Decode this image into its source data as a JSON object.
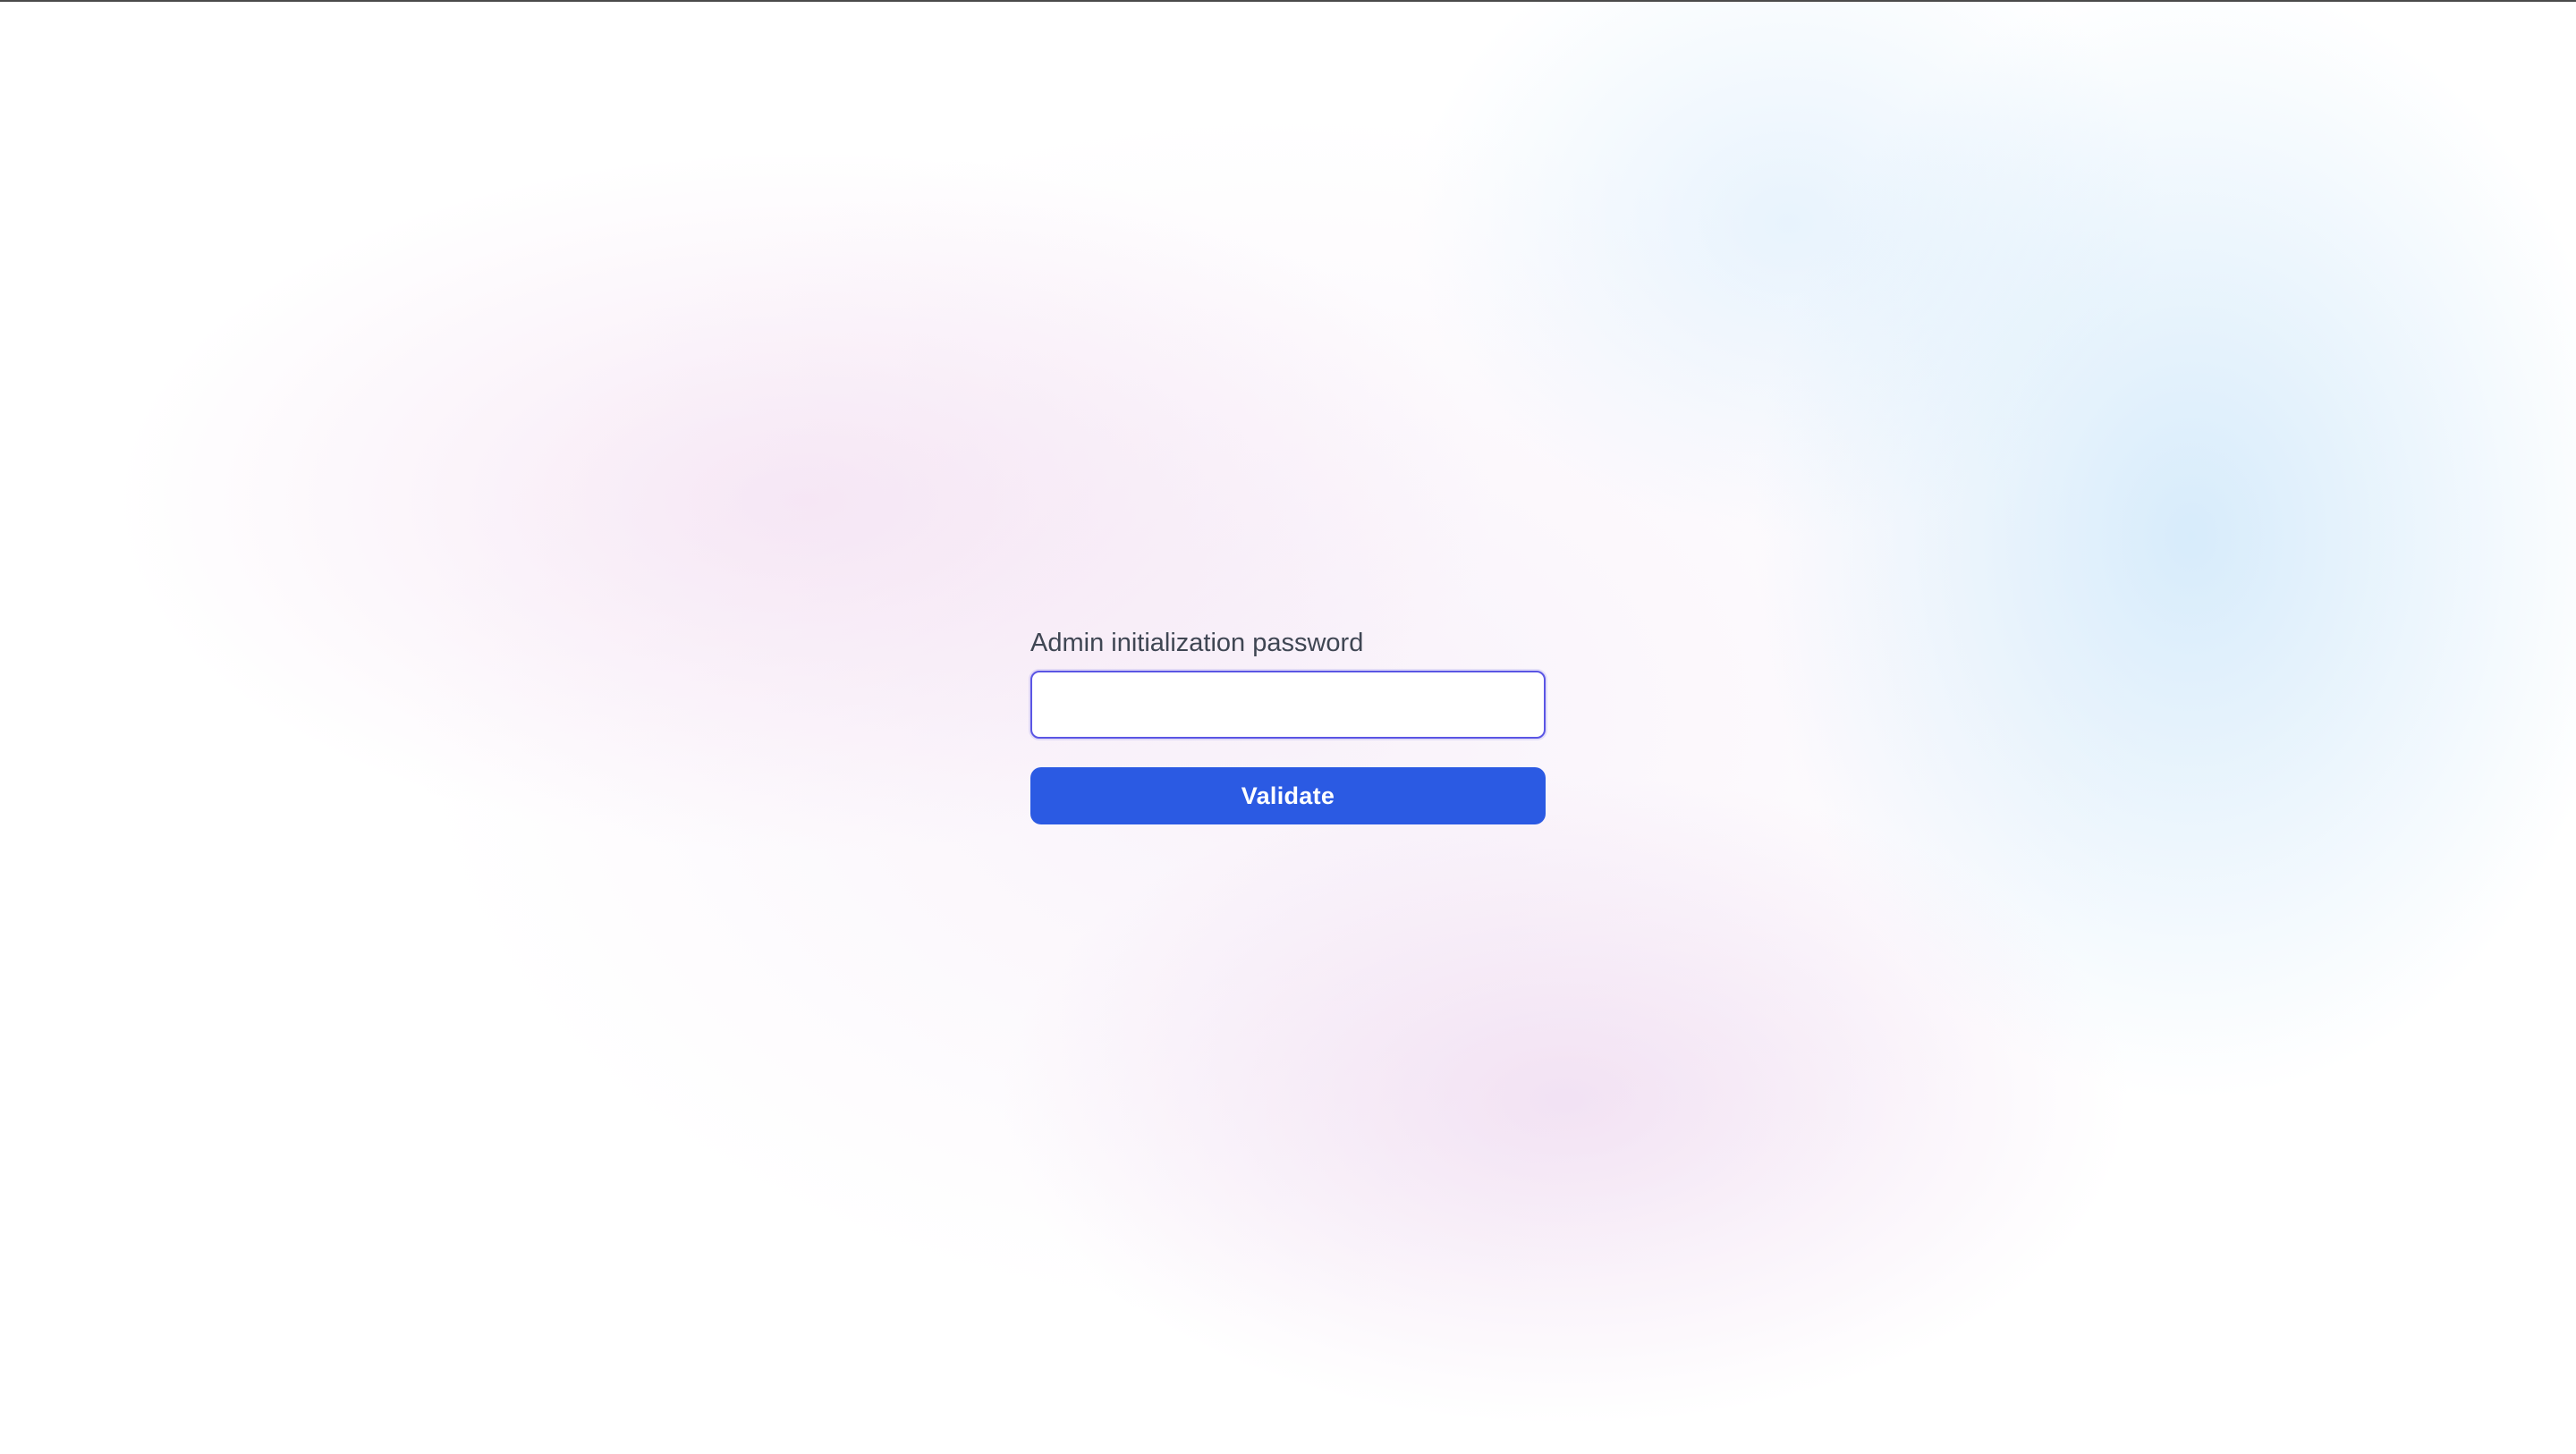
{
  "form": {
    "label": "Admin initialization password",
    "input": {
      "value": "",
      "placeholder": "",
      "type": "password"
    },
    "submit_label": "Validate"
  },
  "colors": {
    "accent": "#2b5ae3",
    "input_focus_border": "#5a55e4",
    "label_text": "#3f4653",
    "button_text": "#ffffff"
  }
}
